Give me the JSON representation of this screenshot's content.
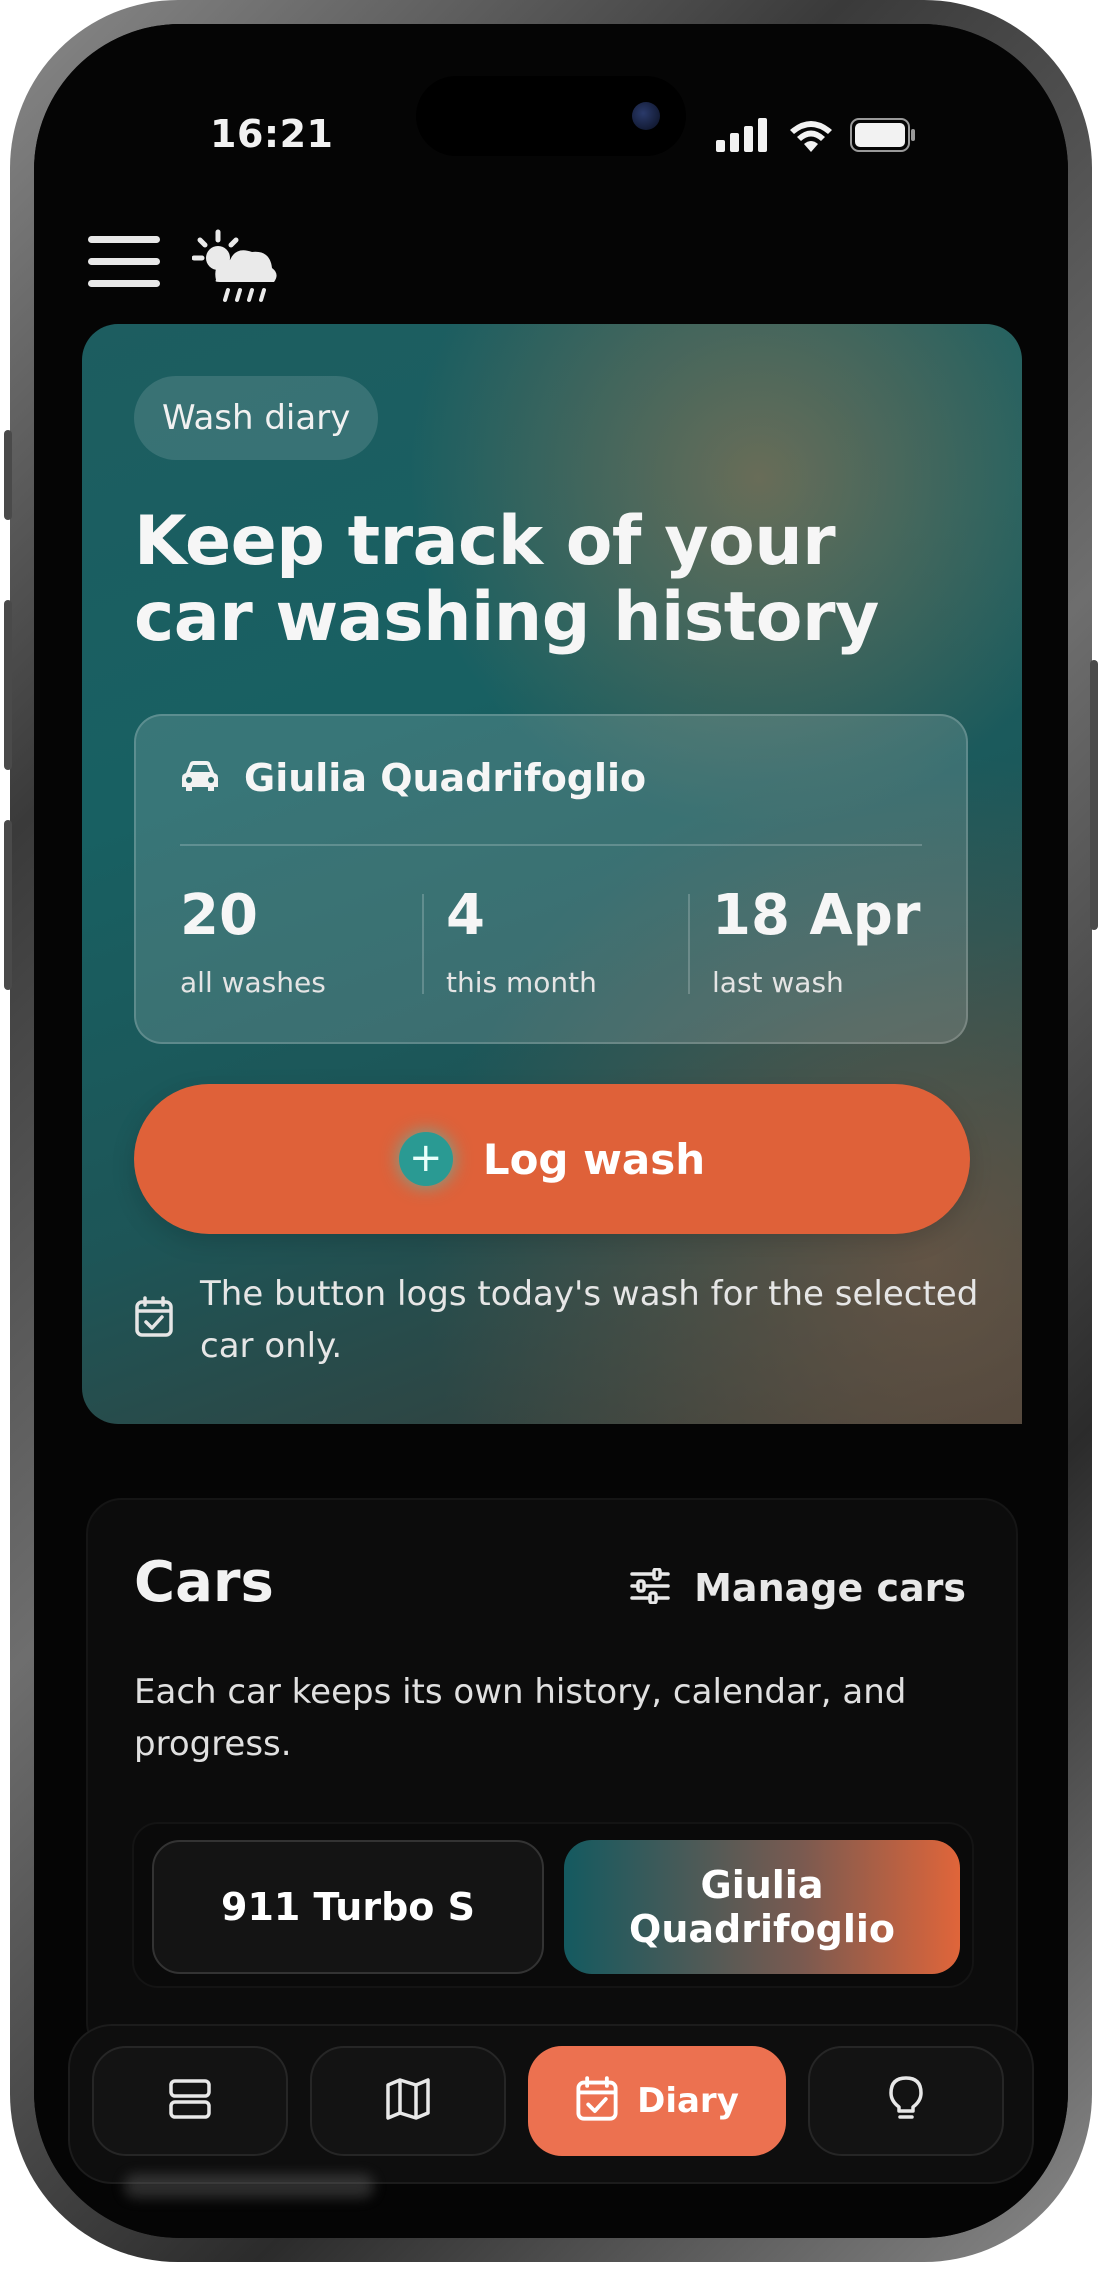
{
  "status_bar": {
    "time": "16:21"
  },
  "hero": {
    "pill_label": "Wash diary",
    "title": "Keep track of your car washing history",
    "selected_car": "Giulia Quadrifoglio",
    "stats": [
      {
        "value": "20",
        "label": "all washes"
      },
      {
        "value": "4",
        "label": "this month"
      },
      {
        "value": "18 Apr",
        "label": "last wash"
      }
    ],
    "log_button_label": "Log wash",
    "log_button_icon": "plus-icon",
    "hint_text": "The button logs today's wash for the selected car only."
  },
  "cars": {
    "title": "Cars",
    "manage_label": "Manage cars",
    "description": "Each car keeps its own history, calendar, and progress.",
    "tabs": [
      {
        "label": "911 Turbo S",
        "active": false
      },
      {
        "label": "Giulia Quadrifoglio",
        "active": true
      }
    ]
  },
  "nav": {
    "items": [
      {
        "icon": "layers-icon",
        "label": ""
      },
      {
        "icon": "map-icon",
        "label": ""
      },
      {
        "icon": "calendar-check-icon",
        "label": "Diary",
        "active": true
      },
      {
        "icon": "lightbulb-icon",
        "label": ""
      }
    ]
  },
  "colors": {
    "accent": "#df6139",
    "nav_active": "#ec7150",
    "teal": "#1d5d60"
  }
}
